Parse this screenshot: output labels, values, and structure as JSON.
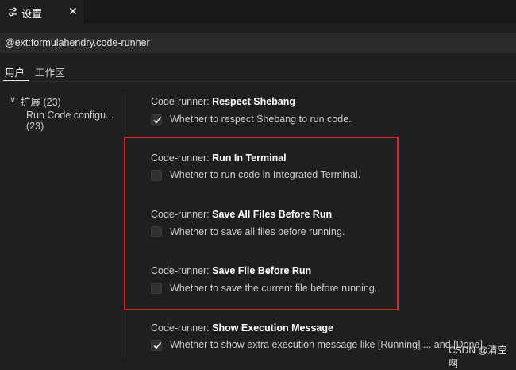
{
  "tab": {
    "title": "设置",
    "close": "✕",
    "icon": "settings-sliders-icon"
  },
  "search": {
    "query": "@ext:formulahendry.code-runner"
  },
  "scopes": {
    "user": "用户",
    "workspace": "工作区"
  },
  "toc": {
    "expand_glyph": "∨",
    "extensions_label": "扩展 (23)",
    "item_label": "Run Code configu... (23)"
  },
  "settings": [
    {
      "prefix": "Code-runner: ",
      "name": "Respect Shebang",
      "description": "Whether to respect Shebang to run code.",
      "checked": true
    },
    {
      "prefix": "Code-runner: ",
      "name": "Run In Terminal",
      "description": "Whether to run code in Integrated Terminal.",
      "checked": false
    },
    {
      "prefix": "Code-runner: ",
      "name": "Save All Files Before Run",
      "description": "Whether to save all files before running.",
      "checked": false
    },
    {
      "prefix": "Code-runner: ",
      "name": "Save File Before Run",
      "description": "Whether to save the current file before running.",
      "checked": false
    },
    {
      "prefix": "Code-runner: ",
      "name": "Show Execution Message",
      "description": "Whether to show extra execution message like [Running] ... and [Done]",
      "checked": true
    }
  ],
  "watermark": "CSDN @清空啊",
  "colors": {
    "highlight": "#d9232e",
    "background": "#1f1f1f"
  }
}
